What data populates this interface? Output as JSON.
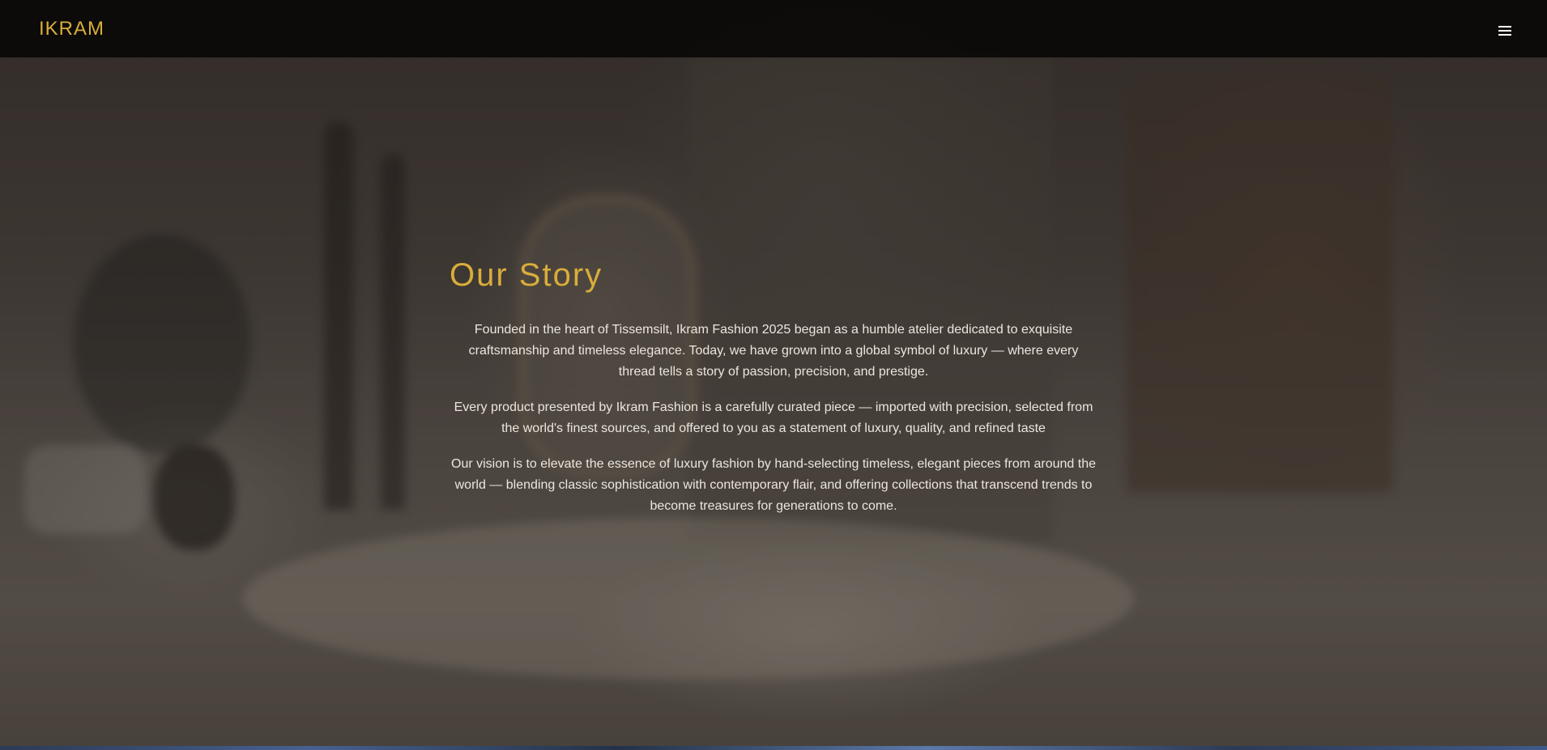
{
  "navbar": {
    "brand": "IKRAM",
    "menu_icon": "hamburger-menu-icon"
  },
  "story": {
    "title": "Our Story",
    "paragraphs": [
      "Founded in the heart of Tissemsilt, Ikram Fashion 2025 began as a humble atelier dedicated to exquisite craftsmanship and timeless elegance. Today, we have grown into a global symbol of luxury — where every thread tells a story of passion, precision, and prestige.",
      "Every product presented by Ikram Fashion is a carefully curated piece — imported with precision, selected from the world's finest sources, and offered to you as a statement of luxury, quality, and refined taste",
      "Our vision is to elevate the essence of luxury fashion by hand-selecting timeless, elegant pieces from around the world — blending classic sophistication with contemporary flair, and offering collections that transcend trends to become treasures for generations to come."
    ]
  },
  "colors": {
    "accent": "#d9ad3a",
    "navbar_bg": "#080706",
    "body_text": "#ece6de"
  }
}
